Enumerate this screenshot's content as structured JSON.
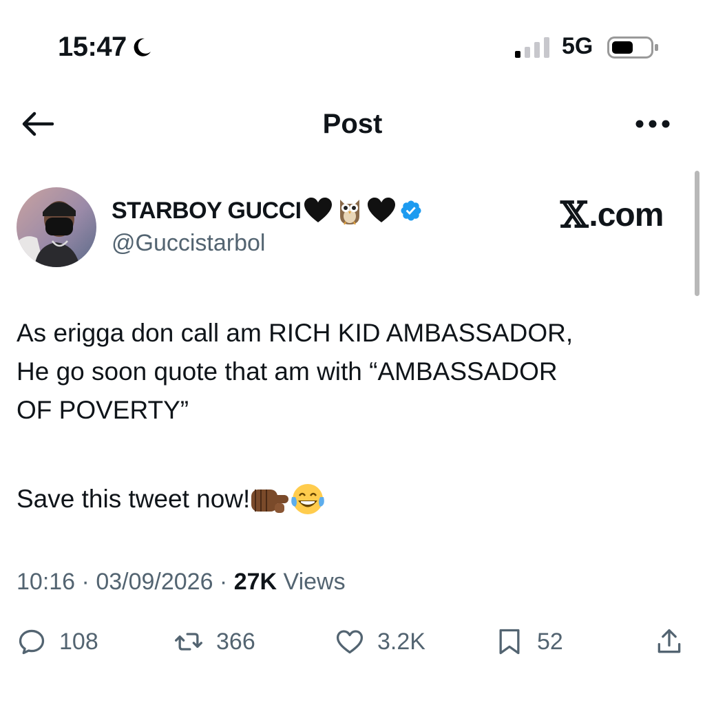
{
  "status_bar": {
    "time": "15:47",
    "network": "5G"
  },
  "nav": {
    "title": "Post"
  },
  "author": {
    "display_name": "STARBOY GUCCI",
    "handle": "@Guccistarbol",
    "verified": true
  },
  "watermark": {
    "x_glyph": "𝕏",
    "suffix": ".com"
  },
  "tweet": {
    "lines": [
      "As erigga don call am RICH KID AMBASSADOR,",
      "He go soon quote that am with “AMBASSADOR",
      "OF POVERTY”"
    ],
    "save_text": "Save this tweet now!"
  },
  "meta": {
    "time": "10:16",
    "date": "03/09/2026",
    "views_count": "27K",
    "views_label": "Views"
  },
  "actions": {
    "replies": "108",
    "reposts": "366",
    "likes": "3.2K",
    "bookmarks": "52"
  },
  "colors": {
    "text": "#0f1419",
    "secondary": "#536471",
    "verified": "#1d9bf0"
  }
}
